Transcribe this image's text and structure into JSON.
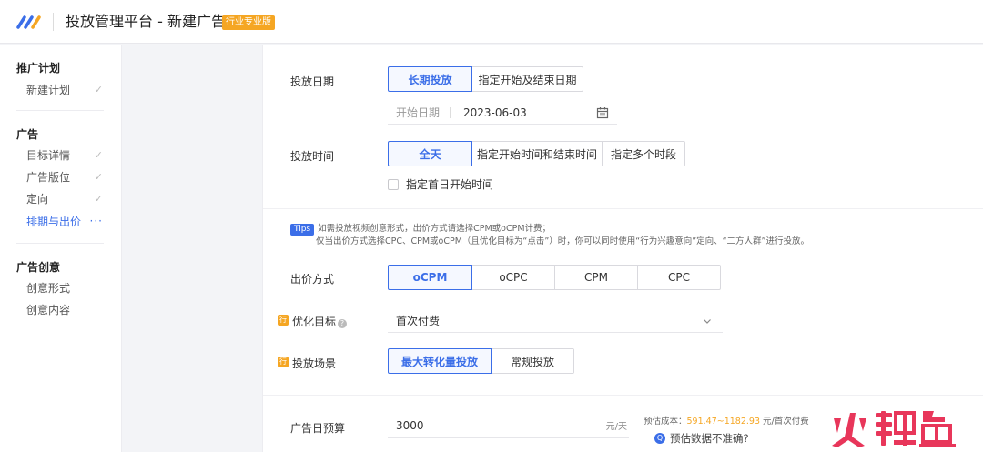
{
  "header": {
    "title": "投放管理平台 - 新建广告",
    "badge": "行业专业版",
    "logo": "brand-logo"
  },
  "sidebar": {
    "groups": [
      {
        "title": "推广计划",
        "items": [
          {
            "label": "新建计划",
            "state": "done"
          }
        ]
      },
      {
        "title": "广告",
        "items": [
          {
            "label": "目标详情",
            "state": "done"
          },
          {
            "label": "广告版位",
            "state": "done"
          },
          {
            "label": "定向",
            "state": "done"
          },
          {
            "label": "排期与出价",
            "state": "active"
          }
        ]
      },
      {
        "title": "广告创意",
        "items": [
          {
            "label": "创意形式",
            "state": ""
          },
          {
            "label": "创意内容",
            "state": ""
          }
        ]
      }
    ],
    "check_glyph": "✓",
    "active_glyph": "···"
  },
  "form": {
    "schedule": {
      "label": "投放日期",
      "options": [
        "长期投放",
        "指定开始及结束日期"
      ],
      "selected": "长期投放",
      "start_placeholder": "开始日期",
      "start_value": "2023-06-03"
    },
    "time": {
      "label": "投放时间",
      "options": [
        "全天",
        "指定开始时间和结束时间",
        "指定多个时段"
      ],
      "selected": "全天",
      "checkbox_label": "指定首日开始时间",
      "checkbox_checked": false
    },
    "tips": {
      "badge": "Tips",
      "line1": "如需投放视频创意形式，出价方式请选择CPM或oCPM计费；",
      "line2": "仅当出价方式选择CPC、CPM或oCPM（且优化目标为“点击”）时，你可以同时使用“行为兴趣意向”定向、“二方人群”进行投放。"
    },
    "bid": {
      "label": "出价方式",
      "options": [
        "oCPM",
        "oCPC",
        "CPM",
        "CPC"
      ],
      "selected": "oCPM"
    },
    "goal": {
      "label": "优化目标",
      "row_badge": "行",
      "help": "?",
      "value": "首次付费"
    },
    "scene": {
      "label": "投放场景",
      "row_badge": "行",
      "options": [
        "最大转化量投放",
        "常规投放"
      ],
      "selected": "最大转化量投放"
    },
    "budget": {
      "label": "广告日预算",
      "value": "3000",
      "unit": "元/天",
      "est_prefix": "预估成本：",
      "est_range": "591.47~1182.93",
      "est_suffix": " 元/首次付费",
      "est_link": "预估数据不准确?",
      "est_link_icon": "Q"
    }
  },
  "colors": {
    "accent": "#3b6ee8",
    "badge": "#f5a623"
  }
}
